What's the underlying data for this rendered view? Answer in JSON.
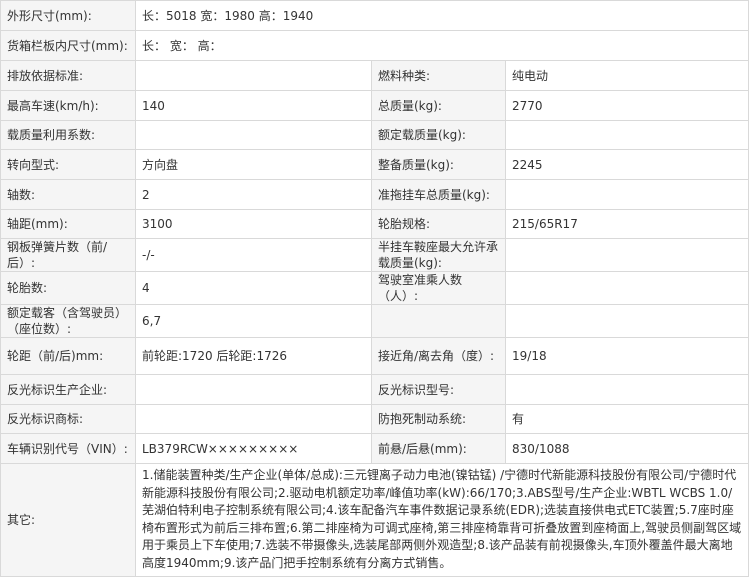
{
  "row1": {
    "label": "外形尺寸(mm):",
    "value": "长：5018 宽：1980 高：1940"
  },
  "row2": {
    "label": "货箱栏板内尺寸(mm):",
    "value": "长：   宽：   高："
  },
  "rows": [
    {
      "l1": "排放依据标准:",
      "v1": "",
      "l2": "燃料种类:",
      "v2": "纯电动"
    },
    {
      "l1": "最高车速(km/h):",
      "v1": "140",
      "l2": "总质量(kg):",
      "v2": "2770"
    },
    {
      "l1": "载质量利用系数:",
      "v1": "",
      "l2": "额定载质量(kg):",
      "v2": ""
    },
    {
      "l1": "转向型式:",
      "v1": "方向盘",
      "l2": "整备质量(kg):",
      "v2": "2245"
    },
    {
      "l1": "轴数:",
      "v1": "2",
      "l2": "准拖挂车总质量(kg):",
      "v2": ""
    },
    {
      "l1": "轴距(mm):",
      "v1": "3100",
      "l2": "轮胎规格:",
      "v2": "215/65R17"
    },
    {
      "l1": "钢板弹簧片数（前/后）:",
      "v1": "-/-",
      "l2": "半挂车鞍座最大允许承载质量(kg):",
      "v2": ""
    },
    {
      "l1": "轮胎数:",
      "v1": "4",
      "l2": "驾驶室准乘人数（人）:",
      "v2": ""
    },
    {
      "l1": "额定载客（含驾驶员）（座位数）:",
      "v1": "6,7",
      "l2": "",
      "v2": ""
    },
    {
      "l1": "轮距（前/后)mm:",
      "v1": "前轮距:1720 后轮距:1726",
      "l2": "接近角/离去角（度）:",
      "v2": "19/18"
    },
    {
      "l1": "反光标识生产企业:",
      "v1": "",
      "l2": "反光标识型号:",
      "v2": ""
    },
    {
      "l1": "反光标识商标:",
      "v1": "",
      "l2": "防抱死制动系统:",
      "v2": "有"
    },
    {
      "l1": "车辆识别代号（VIN）:",
      "v1": "LB379RCW×××××××××",
      "l2": "前悬/后悬(mm):",
      "v2": "830/1088"
    }
  ],
  "other": {
    "label": "其它:",
    "text": "1.储能装置种类/生产企业(单体/总成):三元锂离子动力电池(镍钴锰) /宁德时代新能源科技股份有限公司/宁德时代新能源科技股份有限公司;2.驱动电机额定功率/峰值功率(kW):66/170;3.ABS型号/生产企业:WBTL WCBS 1.0/芜湖伯特利电子控制系统有限公司;4.该车配备汽车事件数据记录系统(EDR);选装直接供电式ETC装置;5.7座时座椅布置形式为前后三排布置;6.第二排座椅为可调式座椅,第三排座椅靠背可折叠放置到座椅面上,驾驶员侧副驾区域用于乘员上下车使用;7.选装不带摄像头,选装尾部两侧外观造型;8.该产品装有前视摄像头,车顶外覆盖件最大离地高度1940mm;9.该产品门把手控制系统有分离方式销售。"
  }
}
